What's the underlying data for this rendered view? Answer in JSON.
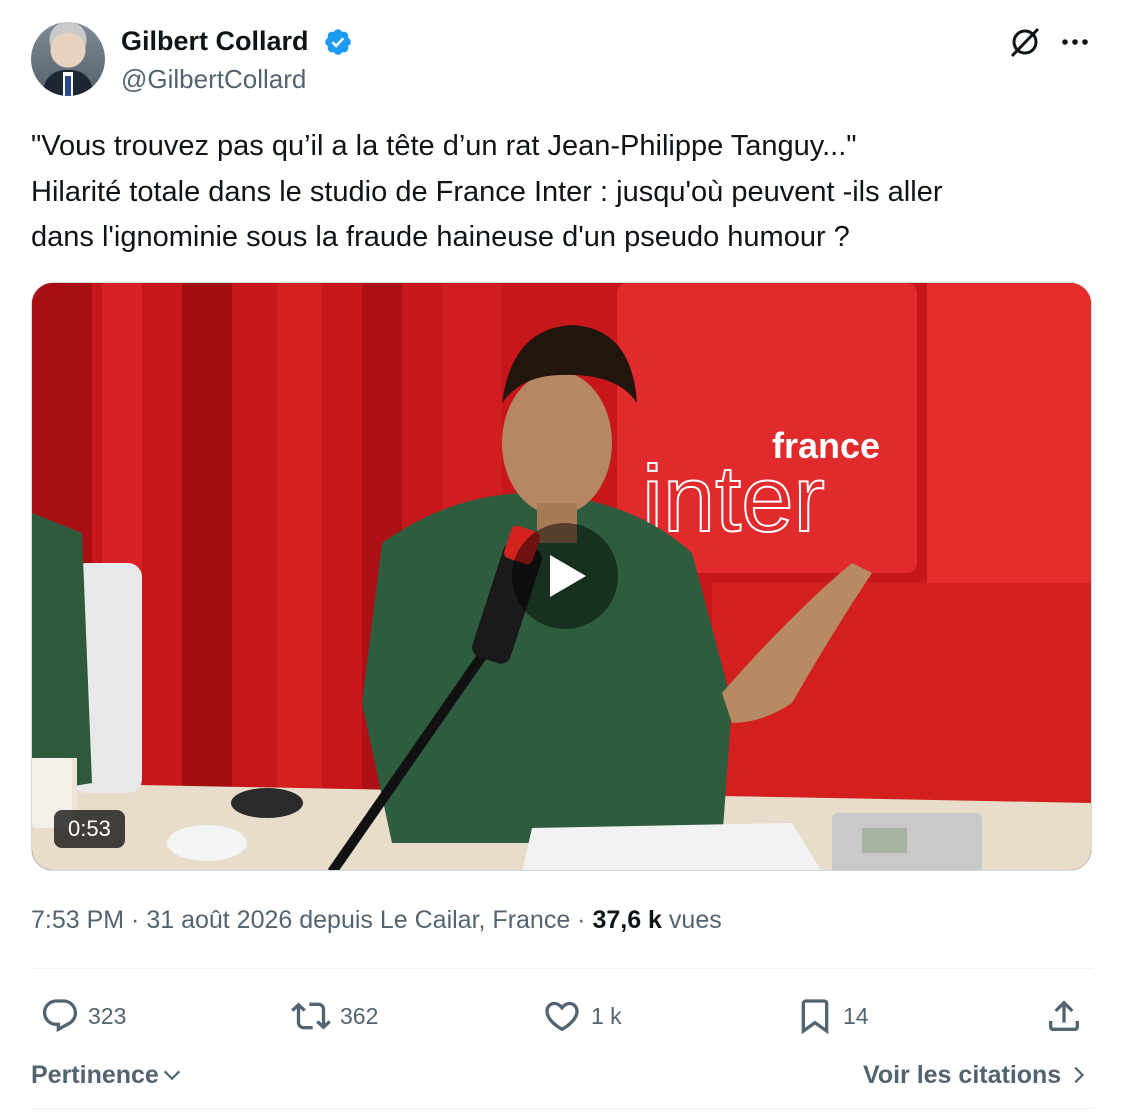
{
  "author": {
    "name": "Gilbert Collard",
    "handle": "@GilbertCollard"
  },
  "tweet": {
    "text": "\"Vous trouvez pas qu’il a la tête d’un rat Jean-Philippe Tanguy...\"\nHilarité totale dans le studio de France Inter : jusqu'où peuvent -ils aller\ndans l'ignominie sous la fraude haineuse  d'un pseudo  humour ?"
  },
  "video": {
    "duration": "0:53",
    "logo_top": "france",
    "logo_bottom": "inter"
  },
  "meta": {
    "time": "7:53 PM",
    "sep1": " · ",
    "date_location": "31 août 2026 depuis Le Cailar, France",
    "sep2": " · ",
    "views_count": "37,6 k",
    "views_label": " vues"
  },
  "actions": {
    "replies": "323",
    "reposts": "362",
    "likes": "1 k",
    "bookmarks": "14"
  },
  "footer": {
    "sort_label": "Pertinence",
    "quotes_label": "Voir les citations"
  },
  "colors": {
    "verified": "#1d9bf0",
    "text_primary": "#0f1419",
    "text_secondary": "#536471",
    "studio_red": "#c8171a"
  },
  "icons": [
    "verified-badge-icon",
    "grok-icon",
    "more-icon",
    "play-icon",
    "reply-icon",
    "repost-icon",
    "like-icon",
    "bookmark-icon",
    "share-icon",
    "chevron-down-icon",
    "chevron-right-icon"
  ]
}
